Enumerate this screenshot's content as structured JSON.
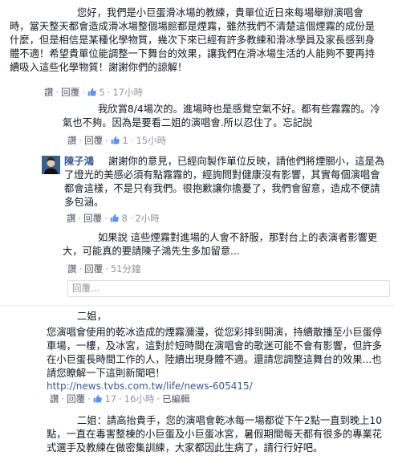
{
  "comment1": {
    "text": "您好，我們是小巨蛋滑冰場的教練，貴單位近日來每場舉辦演唱會時，當天整天都會造成滑冰場整個場館都是煙霧，雖然我們不清楚這個煙霧的成份是什麼，但是相信是某種化學物質，幾次下來已經有許多教練和滑冰學員及家長感到身體不適！希望貴單位能調整一下舞台的效果，讓我們在滑冰場生活的人能夠不要再持續吸入這些化學物質！謝謝你們的諒解！",
    "like_label": "讚",
    "reply_label": "回覆",
    "like_count": "5",
    "time": "17小時"
  },
  "comment2": {
    "text": "我欣賞8/4場次的。進場時也是感覺空氣不好。都有些霧霧的。冷氣也不夠。因為是要看二姐的演唱會.所以忍住了。忘記說",
    "like_label": "讚",
    "reply_label": "回覆",
    "like_count": "1",
    "time": "15小時"
  },
  "reply_chen": {
    "author": "陳子鴻",
    "text": "謝謝你的意見，已經向製作單位反映，請他們將煙關小，這是為了燈光的美感必須有點霧霧的，經詢問對健康沒有影響，其實每個演唱會都會這樣，不是只有我們。很抱歉讓你擔憂了，我們會留意，造成不便請多包涵。",
    "like_label": "讚",
    "reply_label": "回覆",
    "like_count": "8",
    "time": "2小時"
  },
  "reply2": {
    "text": "如果說 這些煙霧對進場的人會不舒服，那對台上的表演者影響更大，可能真的要請陳子鴻先生多加留意...",
    "like_label": "讚",
    "reply_label": "回覆",
    "time": "51分鐘"
  },
  "reply_box": {
    "placeholder": "回覆..."
  },
  "comment3": {
    "greeting": "二姐，",
    "text": "您演唱會使用的乾冰造成的煙霧瀰漫，從您彩排到開演，持續散播至小巨蛋停車場，一樓，及冰宮，這對於短時間在演唱會的歌迷可能不會有影響，但許多在小巨蛋長時間工作的人，陸續出現身體不適。還請您調整這舞台的效果...也請您瞭解一下這則新聞吧！",
    "url": "http://news.tvbs.com.tw/life/news-605415/",
    "like_label": "讚",
    "reply_label": "回覆",
    "like_count": "17",
    "time": "16小時",
    "edited_label": "已編輯"
  },
  "comment4": {
    "text": "二姐：請高抬貴手，您的演唱會乾冰每一場都從下午2點一直到晚上10點，一直在毒害整棟的小巨蛋及小巨蛋冰宮，暑假期間每天都有很多的專業花式選手及教練在做密集訓練，大家都因此生病了，請行行好吧。"
  }
}
